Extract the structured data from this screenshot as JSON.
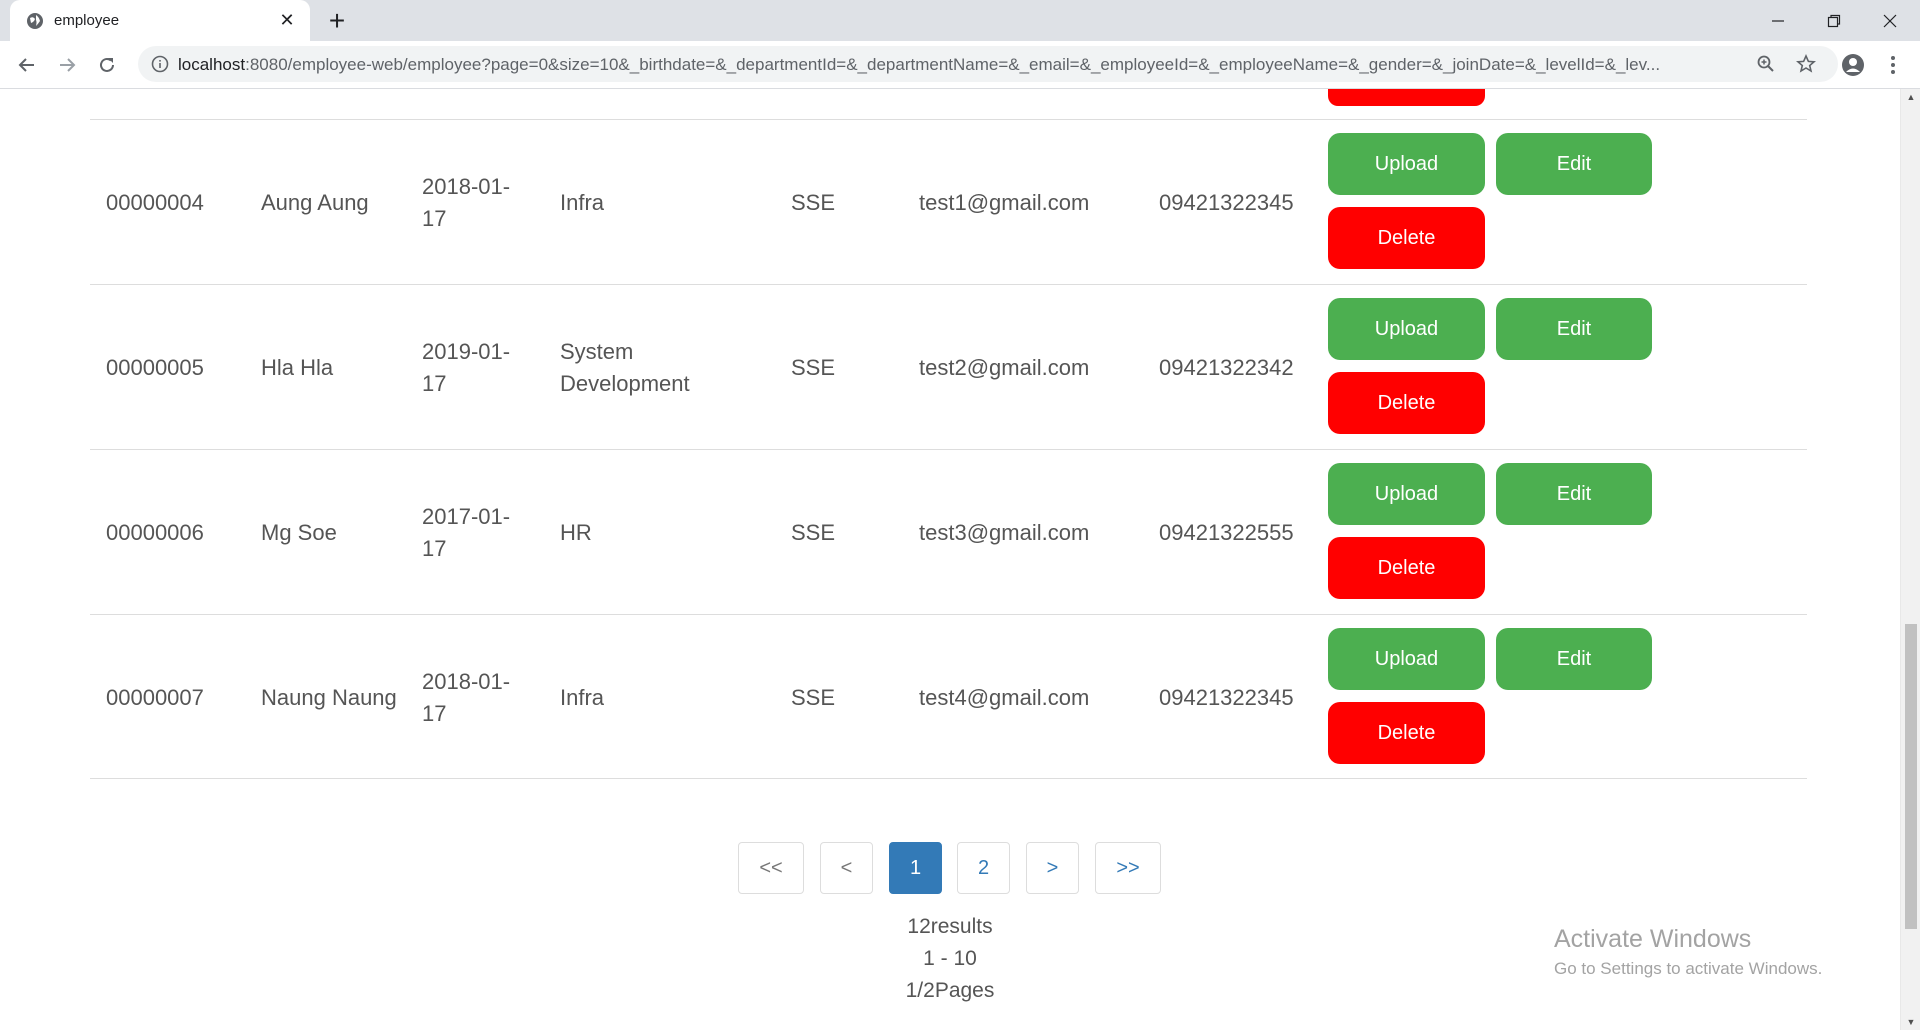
{
  "browser": {
    "tab_title": "employee",
    "url_host": "localhost",
    "url_rest": ":8080/employee-web/employee?page=0&size=10&_birthdate=&_departmentId=&_departmentName=&_email=&_employeeId=&_employeeName=&_gender=&_joinDate=&_levelId=&_lev..."
  },
  "rows": [
    {
      "id": "00000004",
      "name": "Aung Aung",
      "birthdate": "2018-01-17",
      "department": "Infra",
      "level": "SSE",
      "email": "test1@gmail.com",
      "phone": "09421322345",
      "upload": "Upload",
      "edit": "Edit",
      "delete": "Delete"
    },
    {
      "id": "00000005",
      "name": "Hla Hla",
      "birthdate": "2019-01-17",
      "department": "System Development",
      "level": "SSE",
      "email": "test2@gmail.com",
      "phone": "09421322342",
      "upload": "Upload",
      "edit": "Edit",
      "delete": "Delete"
    },
    {
      "id": "00000006",
      "name": "Mg Soe",
      "birthdate": "2017-01-17",
      "department": "HR",
      "level": "SSE",
      "email": "test3@gmail.com",
      "phone": "09421322555",
      "upload": "Upload",
      "edit": "Edit",
      "delete": "Delete"
    },
    {
      "id": "00000007",
      "name": "Naung Naung",
      "birthdate": "2018-01-17",
      "department": "Infra",
      "level": "SSE",
      "email": "test4@gmail.com",
      "phone": "09421322345",
      "upload": "Upload",
      "edit": "Edit",
      "delete": "Delete"
    }
  ],
  "pagination": {
    "first": "<<",
    "prev": "<",
    "pages": [
      "1",
      "2"
    ],
    "current": "1",
    "next": ">",
    "last": ">>"
  },
  "summary": {
    "results": "12results",
    "range": "1 - 10",
    "pages": "1/2Pages"
  },
  "watermark": {
    "title": "Activate Windows",
    "subtitle": "Go to Settings to activate Windows."
  },
  "colors": {
    "success": "#4caf50",
    "danger": "#ff0000",
    "primary": "#337ab7"
  }
}
